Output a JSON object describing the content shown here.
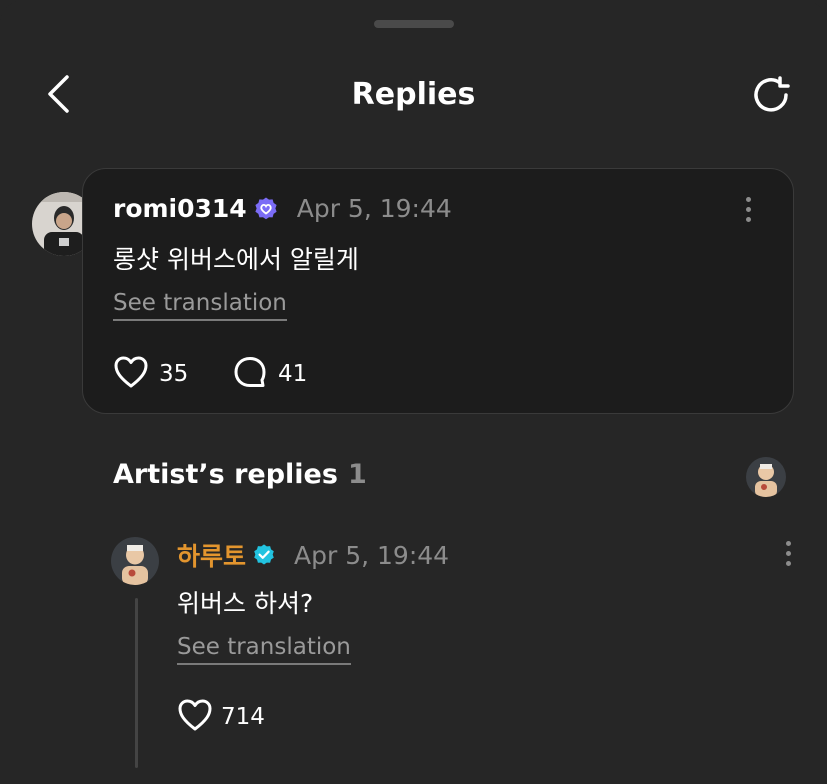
{
  "header": {
    "title": "Replies"
  },
  "post": {
    "username": "romi0314",
    "timestamp": "Apr 5, 19:44",
    "text": "롱샷 위버스에서 알릴게",
    "see_translation": "See translation",
    "likes": "35",
    "comments": "41"
  },
  "artist_replies": {
    "title": "Artist’s replies",
    "count": "1",
    "replies": [
      {
        "username": "하루토",
        "timestamp": "Apr 5, 19:44",
        "text": "위버스 하셔?",
        "see_translation": "See translation",
        "likes": "714"
      }
    ]
  },
  "colors": {
    "background": "#262626",
    "card": "#1c1c1c",
    "artist_name": "#e3952e",
    "fan_badge": "#7b6cf6",
    "artist_badge": "#22c3e0",
    "muted_text": "#8c8c8c"
  },
  "icons": {
    "back": "chevron-left-icon",
    "refresh": "refresh-icon",
    "like": "heart-icon",
    "comment": "speech-bubble-icon",
    "more": "vertical-dots-icon"
  }
}
